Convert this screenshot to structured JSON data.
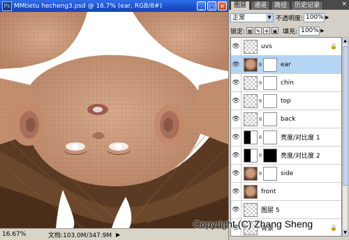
{
  "document": {
    "title": "MMtietu hecheng3.psd @ 16.7% (ear, RGB/8#)",
    "app_icon": "Ps",
    "status": {
      "zoom": "16.67%",
      "info": "文档:103.0M/347.9M"
    }
  },
  "panel": {
    "tabs": [
      "图层",
      "通道",
      "路径",
      "历史记录"
    ],
    "blend_mode": "正常",
    "opacity_label": "不透明度:",
    "opacity_value": "100%",
    "lock_label": "锁定:",
    "fill_label": "填充:",
    "fill_value": "100%",
    "layers": [
      {
        "name": "uvs",
        "locked": true,
        "has_mask": false,
        "selected": false,
        "thumb": "checker"
      },
      {
        "name": "ear",
        "locked": false,
        "has_mask": true,
        "selected": true,
        "thumb": "face"
      },
      {
        "name": "chin",
        "locked": false,
        "has_mask": true,
        "selected": false,
        "thumb": "checker"
      },
      {
        "name": "top",
        "locked": false,
        "has_mask": true,
        "selected": false,
        "thumb": "checker"
      },
      {
        "name": "back",
        "locked": false,
        "has_mask": true,
        "selected": false,
        "thumb": "checker"
      },
      {
        "name": "亮度/对比度 1",
        "locked": false,
        "has_mask": true,
        "selected": false,
        "thumb": "adjust"
      },
      {
        "name": "亮度/对比度 2",
        "locked": false,
        "has_mask": true,
        "selected": false,
        "thumb": "adjust"
      },
      {
        "name": "side",
        "locked": false,
        "has_mask": true,
        "selected": false,
        "thumb": "face"
      },
      {
        "name": "front",
        "locked": false,
        "has_mask": false,
        "selected": false,
        "thumb": "face"
      },
      {
        "name": "图层 5",
        "locked": false,
        "has_mask": false,
        "selected": false,
        "thumb": "checker"
      },
      {
        "name": "背景",
        "locked": true,
        "has_mask": false,
        "selected": false,
        "thumb": "checker"
      }
    ]
  },
  "watermark": "Copyright (C) Zhang Sheng",
  "colors": {
    "titlebar": "#1a4fc9",
    "selected_layer": "#b4d4f4",
    "skin": "#c99a7c",
    "hair": "#5a3a22"
  }
}
